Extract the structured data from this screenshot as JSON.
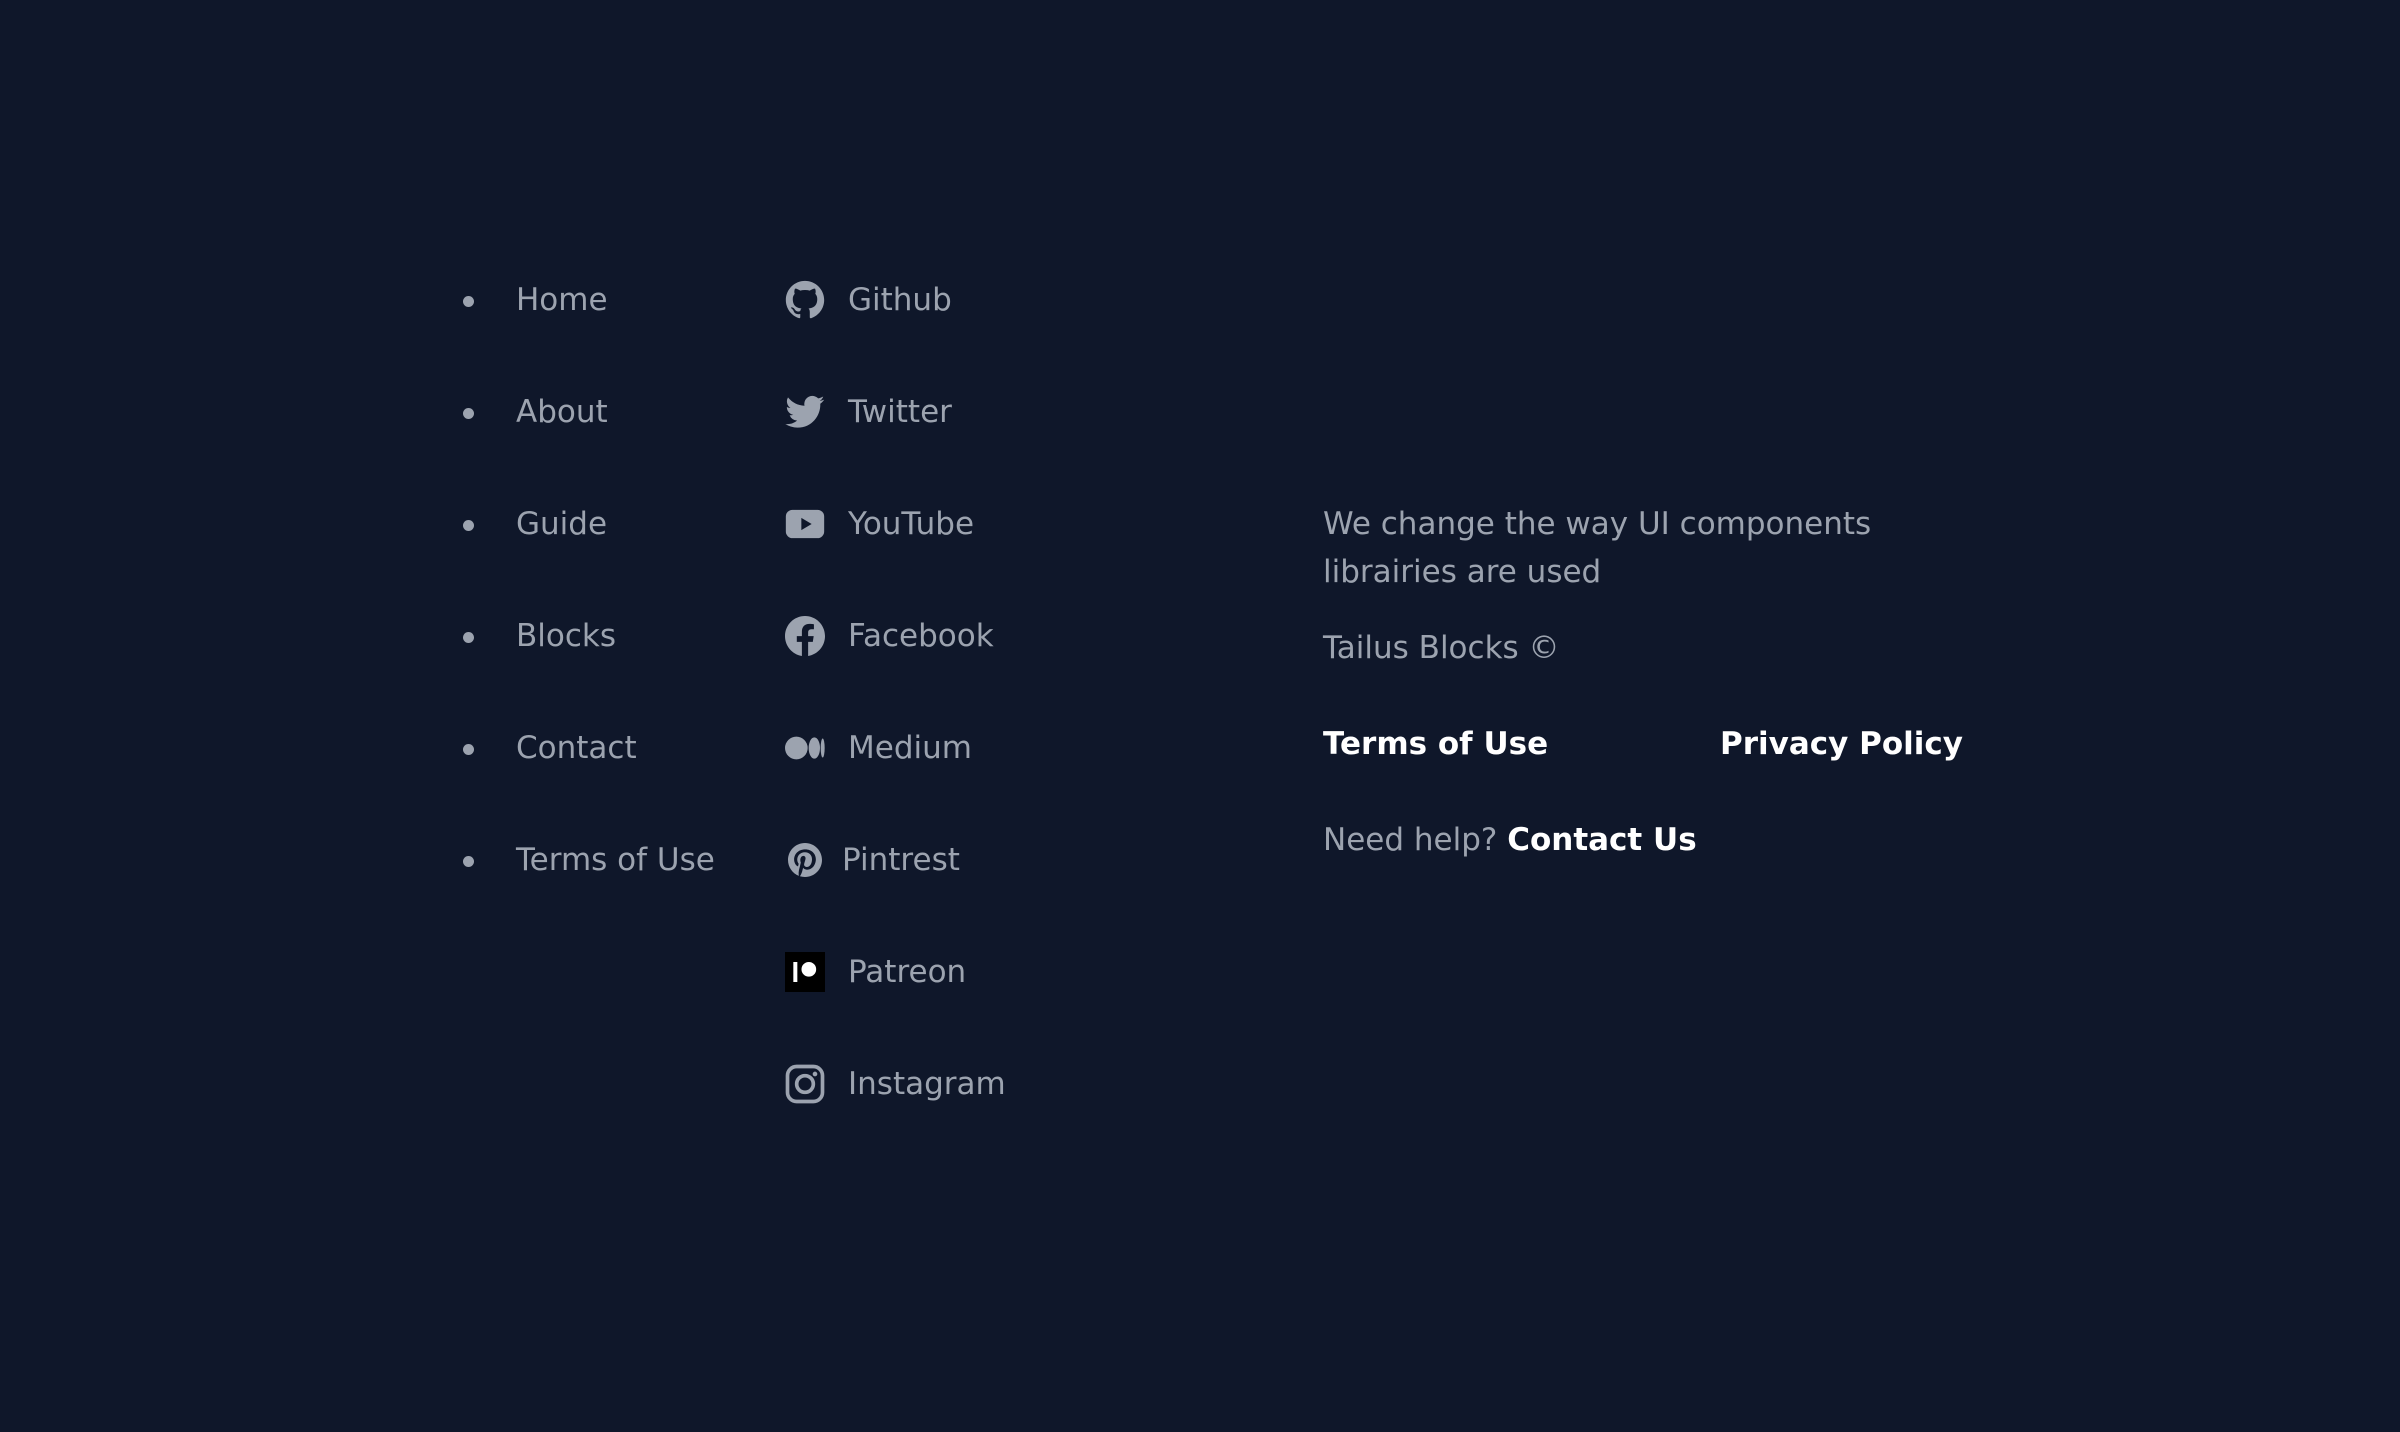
{
  "nav": {
    "items": [
      {
        "label": "Home"
      },
      {
        "label": "About"
      },
      {
        "label": "Guide"
      },
      {
        "label": "Blocks"
      },
      {
        "label": "Contact"
      },
      {
        "label": "Terms of Use"
      }
    ]
  },
  "social": {
    "items": [
      {
        "label": "Github",
        "icon": "github-icon"
      },
      {
        "label": "Twitter",
        "icon": "twitter-icon"
      },
      {
        "label": "YouTube",
        "icon": "youtube-icon"
      },
      {
        "label": "Facebook",
        "icon": "facebook-icon"
      },
      {
        "label": "Medium",
        "icon": "medium-icon"
      },
      {
        "label": "Pintrest",
        "icon": "pinterest-icon"
      },
      {
        "label": "Patreon",
        "icon": "patreon-icon"
      },
      {
        "label": "Instagram",
        "icon": "instagram-icon"
      }
    ]
  },
  "about": {
    "tagline": "We change the way UI components librairies are used",
    "copyright": "Tailus Blocks ©",
    "terms_label": "Terms of Use",
    "privacy_label": "Privacy Policy",
    "help_text": "Need help?",
    "contact_label": "Contact Us"
  },
  "colors": {
    "background": "#0f172a",
    "muted_text": "#9ca3af",
    "emphasis_text": "#ffffff"
  }
}
